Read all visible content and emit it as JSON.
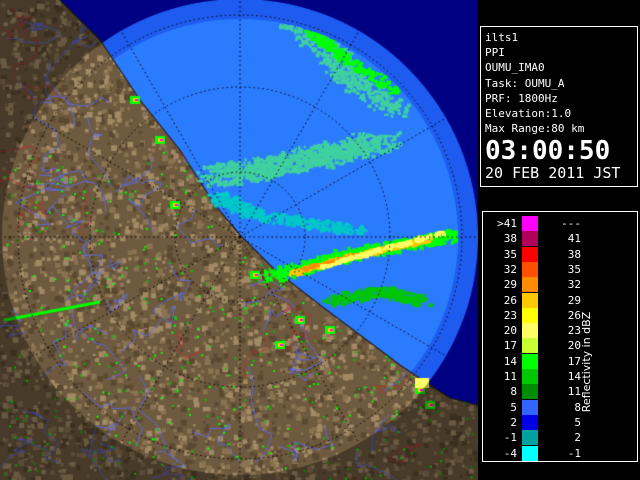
{
  "info": {
    "site": "ilts1",
    "mode": "PPI",
    "product": "OUMU_IMA0",
    "task": "Task: OUMU_A",
    "prf": "PRF: 1800Hz",
    "elevation": "Elevation:1.0",
    "max_range": "Max Range:80 km",
    "time": "03:00:50",
    "date": "20 FEB 2011 JST"
  },
  "legend": {
    "unit": "Reflectivity in dBZ",
    "rows": [
      {
        "left": ">41",
        "right": "---",
        "color": "#ff00ff"
      },
      {
        "left": "38",
        "right": "41",
        "color": "#b0005a"
      },
      {
        "left": "35",
        "right": "38",
        "color": "#ff0000"
      },
      {
        "left": "32",
        "right": "35",
        "color": "#ff5000"
      },
      {
        "left": "29",
        "right": "32",
        "color": "#ff8c00"
      },
      {
        "left": "26",
        "right": "29",
        "color": "#ffc800"
      },
      {
        "left": "23",
        "right": "26",
        "color": "#ffff00"
      },
      {
        "left": "20",
        "right": "23",
        "color": "#ffff64"
      },
      {
        "left": "17",
        "right": "20",
        "color": "#c8ff32"
      },
      {
        "left": "14",
        "right": "17",
        "color": "#00ff00"
      },
      {
        "left": "11",
        "right": "14",
        "color": "#00c800"
      },
      {
        "left": "8",
        "right": "11",
        "color": "#008c00"
      },
      {
        "left": "5",
        "right": "8",
        "color": "#3264ff"
      },
      {
        "left": "2",
        "right": "5",
        "color": "#0000e6"
      },
      {
        "left": "-1",
        "right": "2",
        "color": "#00a0a0"
      },
      {
        "left": "-4",
        "right": "-1",
        "color": "#00ffff"
      }
    ]
  },
  "colors": {
    "sea_clear": "#2b7bff",
    "sea_far": "#1e5cf0",
    "outside": "#0000c8",
    "land": "#6e5a3e",
    "river": "#5a6cff"
  }
}
